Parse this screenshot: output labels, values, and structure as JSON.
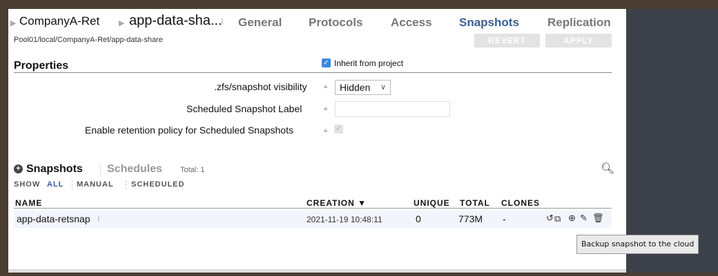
{
  "breadcrumb": {
    "project": "CompanyA-Ret",
    "share": "app-data-sha..."
  },
  "tabs": [
    "General",
    "Protocols",
    "Access",
    "Snapshots",
    "Replication"
  ],
  "active_tab": "Snapshots",
  "path": "Pool01/local/CompanyA-Ret/app-data-share",
  "buttons": {
    "revert": "REVERT",
    "apply": "APPLY"
  },
  "properties": {
    "title": "Properties",
    "inherit_label": "Inherit from project",
    "visibility_label": ".zfs/snapshot visibility",
    "visibility_value": "Hidden",
    "scheduled_label_label": "Scheduled Snapshot Label",
    "scheduled_label_value": "",
    "retention_label": "Enable retention policy for Scheduled Snapshots"
  },
  "snapshots": {
    "tab_snapshots": "Snapshots",
    "tab_schedules": "Schedules",
    "total": "Total: 1",
    "show_label": "SHOW",
    "filters": [
      "ALL",
      "MANUAL",
      "SCHEDULED"
    ],
    "active_filter": "ALL",
    "columns": [
      "NAME",
      "CREATION ▼",
      "UNIQUE",
      "TOTAL",
      "CLONES"
    ],
    "rows": [
      {
        "name": "app-data-retsnap",
        "creation": "2021-11-19 10:48:11",
        "unique": "0",
        "total": "773M",
        "clones": "-"
      }
    ]
  },
  "tooltip": "Backup snapshot to the cloud",
  "icons": {
    "rollback": "rollback-icon",
    "clone": "clone-icon",
    "cloud_backup": "cloud-backup-icon",
    "edit": "pencil-icon",
    "delete": "trash-icon",
    "search": "search-icon"
  },
  "colors": {
    "accent": "#3b5e96",
    "checkbox": "#3e86e6"
  }
}
